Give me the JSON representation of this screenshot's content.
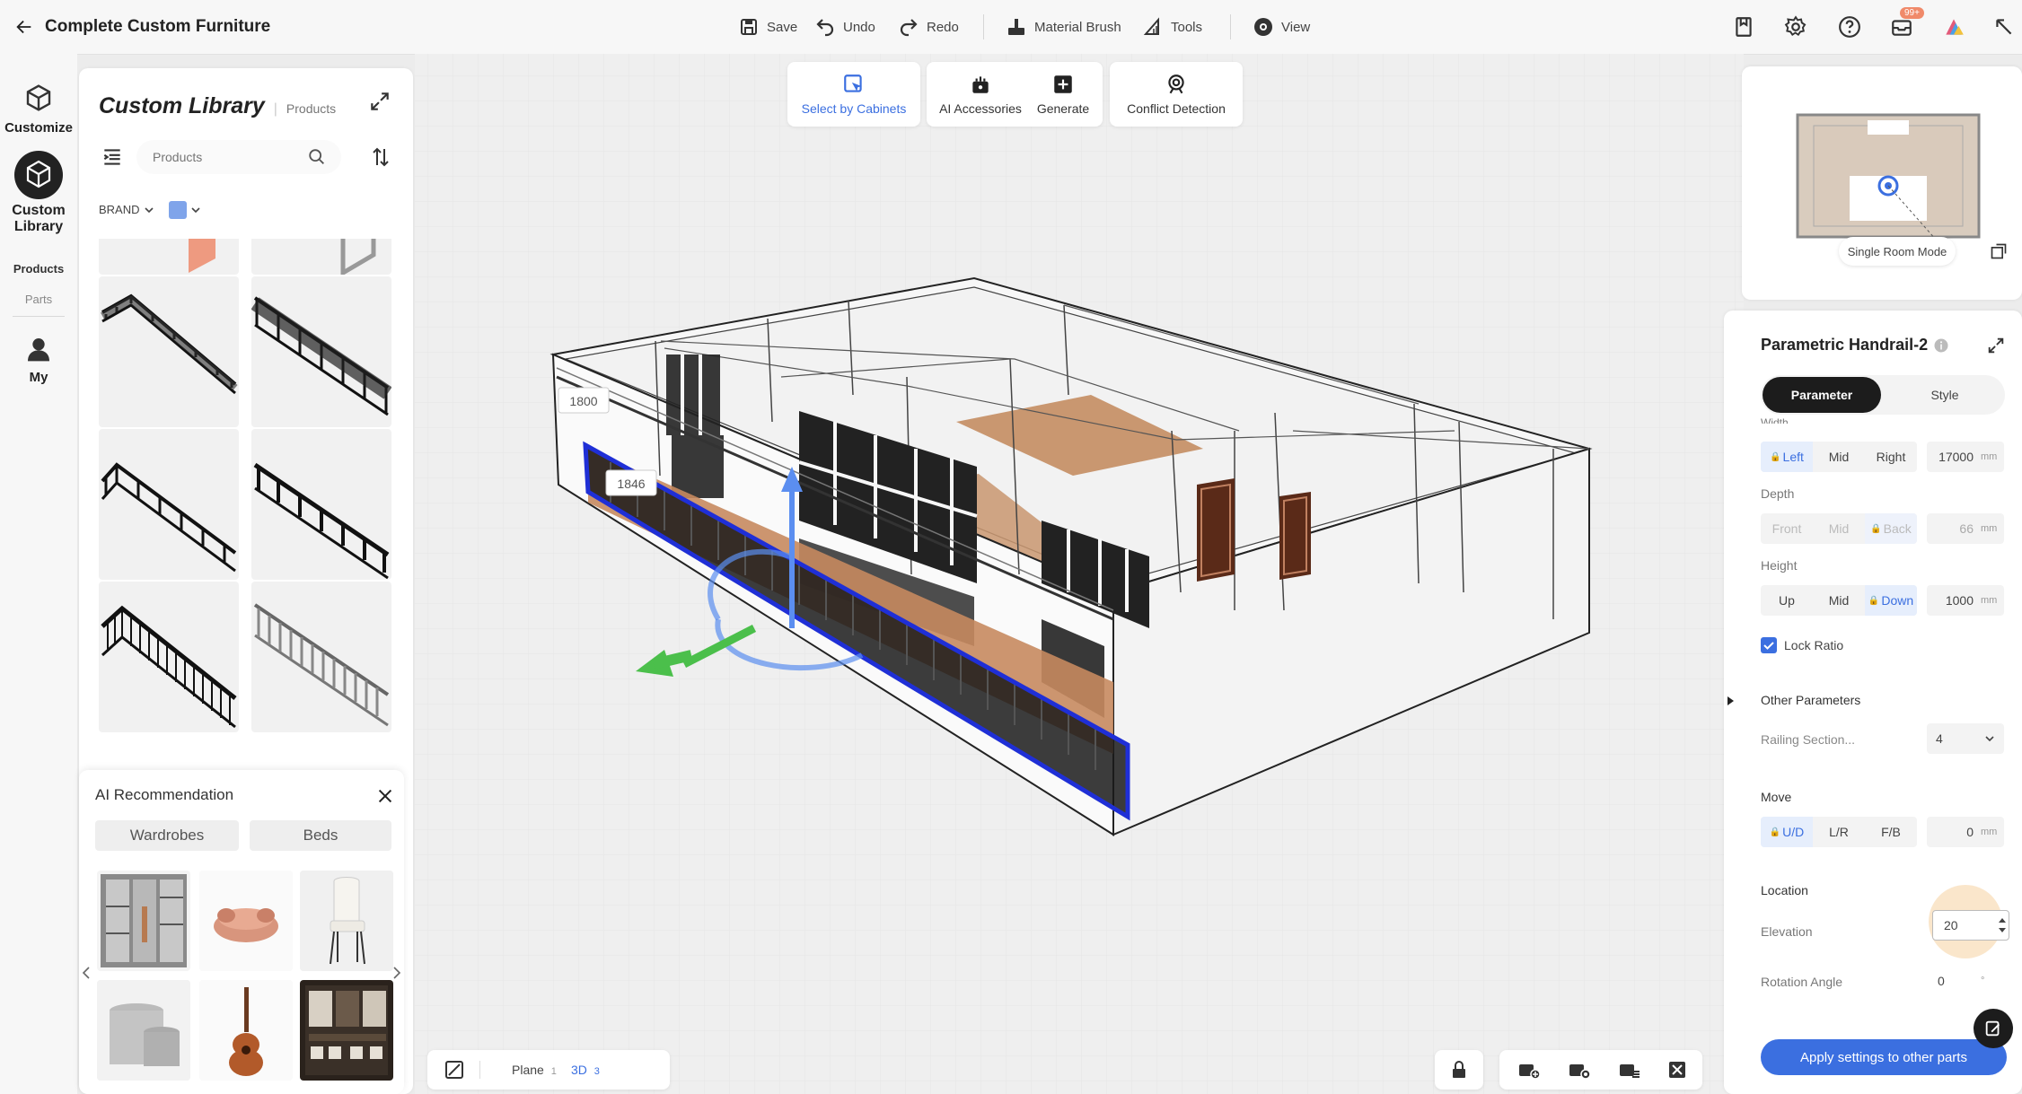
{
  "header": {
    "title": "Complete Custom Furniture",
    "save": "Save",
    "undo": "Undo",
    "redo": "Redo",
    "material_brush": "Material Brush",
    "tools": "Tools",
    "view": "View",
    "notification_badge": "99+"
  },
  "rail": {
    "customize": "Customize",
    "custom_library_1": "Custom",
    "custom_library_2": "Library",
    "products": "Products",
    "parts": "Parts",
    "my": "My"
  },
  "library": {
    "title": "Custom Library",
    "subtitle": "Products",
    "search_placeholder": "Products",
    "brand_filter": "BRAND"
  },
  "ai": {
    "title": "AI Recommendation",
    "tabs": [
      "Wardrobes",
      "Beds"
    ]
  },
  "toolbar": {
    "select_by_cabinets": "Select by Cabinets",
    "ai_accessories": "AI Accessories",
    "generate": "Generate",
    "conflict_detection": "Conflict Detection"
  },
  "viewport": {
    "dim_1": "1800",
    "dim_2": "1846"
  },
  "bottom_bar": {
    "plane": "Plane",
    "plane_sub": "1",
    "view3d": "3D",
    "view3d_sub": "3"
  },
  "minimap": {
    "mode": "Single Room Mode"
  },
  "props": {
    "title": "Parametric Handrail-2",
    "tab_parameter": "Parameter",
    "tab_style": "Style",
    "width_label": "Width",
    "width_opts": [
      "Left",
      "Mid",
      "Right"
    ],
    "width_value": "17000",
    "depth_label": "Depth",
    "depth_opts": [
      "Front",
      "Mid",
      "Back"
    ],
    "depth_value": "66",
    "height_label": "Height",
    "height_opts": [
      "Up",
      "Mid",
      "Down"
    ],
    "height_value": "1000",
    "unit": "mm",
    "lock_ratio": "Lock Ratio",
    "other_params": "Other Parameters",
    "railing_section": "Railing Section...",
    "railing_value": "4",
    "move_label": "Move",
    "move_opts": [
      "U/D",
      "L/R",
      "F/B"
    ],
    "move_value": "0",
    "location_label": "Location",
    "elevation_label": "Elevation",
    "elevation_value": "20",
    "rotation_label": "Rotation Angle",
    "rotation_value": "0",
    "rotation_unit": "°",
    "apply_button": "Apply settings to other parts"
  },
  "colors": {
    "accent": "#3b6fe0",
    "selection": "#1f2fd6",
    "gizmo_blue": "#5b8ef0",
    "gizmo_green": "#4bbf4b"
  }
}
